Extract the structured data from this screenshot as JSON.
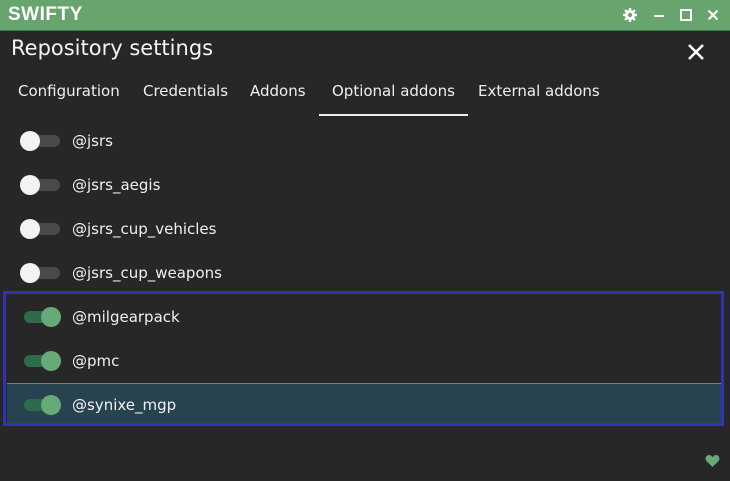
{
  "app": {
    "name": "SWIFTY"
  },
  "window_controls": [
    "gear-icon",
    "minimize-icon",
    "maximize-icon",
    "close-icon"
  ],
  "dialog": {
    "title": "Repository settings"
  },
  "tabs": [
    {
      "label": "Configuration",
      "active": false
    },
    {
      "label": "Credentials",
      "active": false
    },
    {
      "label": "Addons",
      "active": false
    },
    {
      "label": "Optional addons",
      "active": true
    },
    {
      "label": "External addons",
      "active": false
    }
  ],
  "addons": [
    {
      "name": "@jsrs",
      "enabled": false,
      "selected": false
    },
    {
      "name": "@jsrs_aegis",
      "enabled": false,
      "selected": false
    },
    {
      "name": "@jsrs_cup_vehicles",
      "enabled": false,
      "selected": false
    },
    {
      "name": "@jsrs_cup_weapons",
      "enabled": false,
      "selected": false
    },
    {
      "name": "@milgearpack",
      "enabled": true,
      "selected": false
    },
    {
      "name": "@pmc",
      "enabled": true,
      "selected": false
    },
    {
      "name": "@synixe_mgp",
      "enabled": true,
      "selected": true
    }
  ],
  "colors": {
    "titlebar": "#68a56e",
    "background": "#272727",
    "toggle_on": "#67a978",
    "highlight_border": "#3232b4",
    "selected_row": "#27434f"
  },
  "footer": {
    "icon": "heart-icon"
  }
}
